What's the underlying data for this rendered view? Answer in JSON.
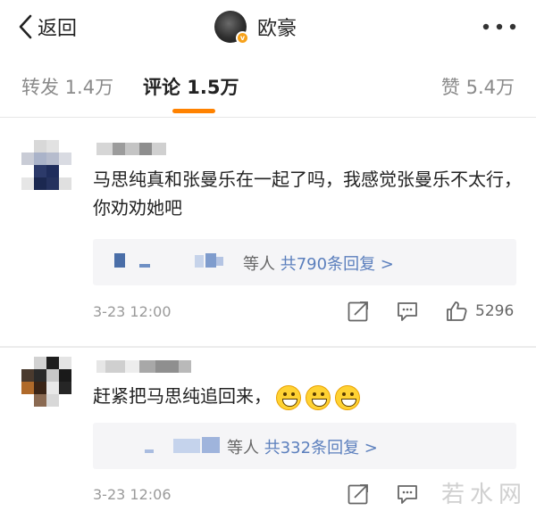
{
  "header": {
    "back_label": "返回",
    "title": "欧豪",
    "verify_mark": "v"
  },
  "tabs": [
    {
      "label": "转发 1.4万",
      "active": false
    },
    {
      "label": "评论 1.5万",
      "active": true
    },
    {
      "label": "赞 5.4万",
      "active": false
    }
  ],
  "comments": [
    {
      "text": "马思纯真和张曼乐在一起了吗，我感觉张曼乐不太行，你劝劝她吧",
      "reply_suffix": "等人",
      "reply_link": "共790条回复 >",
      "time": "3-23 12:00",
      "likes": "5296"
    },
    {
      "text": "赶紧把马思纯追回来，",
      "emoji_count": 3,
      "reply_suffix": "等人",
      "reply_link": "共332条回复 >",
      "time": "3-23 12:06"
    }
  ],
  "watermark": "若水网",
  "colors": {
    "accent": "#ff8200",
    "link": "#5b7fbd",
    "verify": "#f7a21b"
  }
}
